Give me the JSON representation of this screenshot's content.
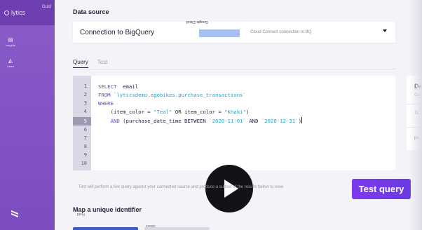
{
  "sidebar": {
    "brand": "lytics",
    "top_right": "Guid",
    "items": [
      {
        "label": "Insights",
        "icon": "document-icon"
      },
      {
        "label": "Learn",
        "icon": "chart-icon"
      }
    ]
  },
  "data_source": {
    "title": "Data source",
    "selected": "Connection to BigQuery",
    "provider_label": "Google Cloud",
    "description": "Cloud Connect connection to BQ"
  },
  "tabs": [
    {
      "label": "Query",
      "active": true
    },
    {
      "label": "Test",
      "active": false
    }
  ],
  "editor": {
    "line_numbers": [
      "1",
      "2",
      "3",
      "4",
      "5",
      "6",
      "7",
      "8",
      "9",
      "10"
    ],
    "active_line": 5,
    "lines": [
      {
        "kw": "SELECT",
        "rest": "  email"
      },
      {
        "kw": "FROM",
        "str": "`lyticsdemo.egobikes.purchase_transactions`"
      },
      {
        "kw": "WHERE"
      },
      {
        "pre": "    (item_color = ",
        "str": "\"Teal\"",
        "mid": " OR item_color = ",
        "str2": "\"Khaki\"",
        "post": ")"
      },
      {
        "pre": "    ",
        "kw": "AND",
        "mid": " (purchase_date_time BETWEEN ",
        "str": "`2020-11-01`",
        "mid2": " AND ",
        "str2": "`2020-12-31`",
        "post": ")"
      }
    ]
  },
  "preview": {
    "title": "Da",
    "subtitle": "Co",
    "label": "Ta",
    "link": "pu"
  },
  "hint": "Test will perform a live query against your connected source and produce a subset of the results below to view",
  "test_button": "Test query",
  "identifier": {
    "title": "Map a unique identifier",
    "ghost_left": "Field",
    "ghost_right": "Select"
  },
  "colors": {
    "accent": "#7c3aed",
    "sidebar": "#8a5cc9",
    "keyword": "#6d4ad6",
    "string": "#2aa1c7"
  }
}
